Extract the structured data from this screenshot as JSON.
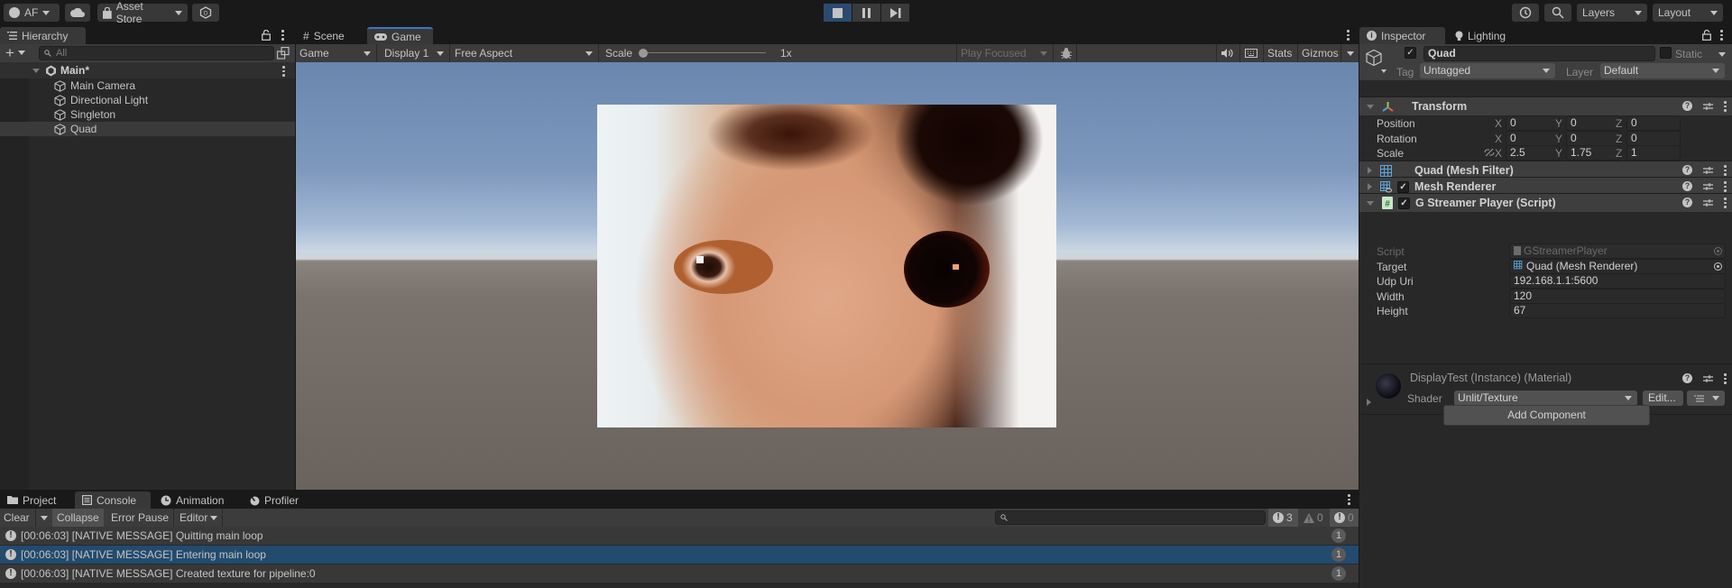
{
  "toolbar": {
    "account_label": "AF",
    "asset_store_label": "Asset Store",
    "layers_label": "Layers",
    "layout_label": "Layout",
    "play_state": "playing"
  },
  "hierarchy": {
    "tab_label": "Hierarchy",
    "search_placeholder": "All",
    "scene_name": "Main*",
    "items": [
      {
        "label": "Main Camera",
        "selected": false
      },
      {
        "label": "Directional Light",
        "selected": false
      },
      {
        "label": "Singleton",
        "selected": false
      },
      {
        "label": "Quad",
        "selected": true
      }
    ]
  },
  "game_view": {
    "tabs": [
      {
        "label": "Scene"
      },
      {
        "label": "Game",
        "active": true
      }
    ],
    "mode_dropdown": "Game",
    "display_dropdown": "Display 1",
    "aspect_dropdown": "Free Aspect",
    "scale_label": "Scale",
    "scale_value": "1x",
    "play_mode_dropdown": "Play Focused",
    "stats_label": "Stats",
    "gizmos_label": "Gizmos"
  },
  "inspector": {
    "tabs": [
      {
        "label": "Inspector",
        "active": true
      },
      {
        "label": "Lighting"
      }
    ],
    "object_name": "Quad",
    "object_active": true,
    "static_label": "Static",
    "static_checked": false,
    "tag_label": "Tag",
    "tag_value": "Untagged",
    "layer_label": "Layer",
    "layer_value": "Default",
    "transform": {
      "title": "Transform",
      "rows": [
        {
          "label": "Position",
          "x": "0",
          "y": "0",
          "z": "0"
        },
        {
          "label": "Rotation",
          "x": "0",
          "y": "0",
          "z": "0"
        },
        {
          "label": "Scale",
          "x": "2.5",
          "y": "1.75",
          "z": "1"
        }
      ],
      "axis_labels": [
        "X",
        "Y",
        "Z"
      ]
    },
    "components": [
      {
        "title": "Quad (Mesh Filter)",
        "expanded": false,
        "has_checkbox": false
      },
      {
        "title": "Mesh Renderer",
        "expanded": false,
        "has_checkbox": true,
        "enabled": true
      },
      {
        "title": "G Streamer Player (Script)",
        "expanded": true,
        "has_checkbox": true,
        "enabled": true
      }
    ],
    "script_fields": [
      {
        "label": "Script",
        "value": "GStreamerPlayer"
      },
      {
        "label": "Target",
        "value": "Quad (Mesh Renderer)"
      },
      {
        "label": "Udp Uri",
        "value": "192.168.1.1:5600"
      },
      {
        "label": "Width",
        "value": "120"
      },
      {
        "label": "Height",
        "value": "67"
      }
    ],
    "material": {
      "title": "DisplayTest (Instance) (Material)",
      "shader_label": "Shader",
      "shader_value": "Unlit/Texture",
      "edit_label": "Edit..."
    },
    "add_component_label": "Add Component"
  },
  "console": {
    "tabs": [
      {
        "label": "Project"
      },
      {
        "label": "Console",
        "active": true
      },
      {
        "label": "Animation"
      },
      {
        "label": "Profiler"
      }
    ],
    "clear_label": "Clear",
    "collapse_label": "Collapse",
    "error_pause_label": "Error Pause",
    "editor_label": "Editor",
    "search_value": "",
    "info_count": "3",
    "warning_count": "0",
    "error_count": "0",
    "messages": [
      {
        "text": "[00:06:03] [NATIVE MESSAGE] Quitting main loop",
        "count": "1",
        "selected": false
      },
      {
        "text": "[00:06:03] [NATIVE MESSAGE] Entering main loop",
        "count": "1",
        "selected": true
      },
      {
        "text": "[00:06:03] [NATIVE MESSAGE] Created texture for pipeline:0",
        "count": "1",
        "selected": false
      }
    ]
  }
}
